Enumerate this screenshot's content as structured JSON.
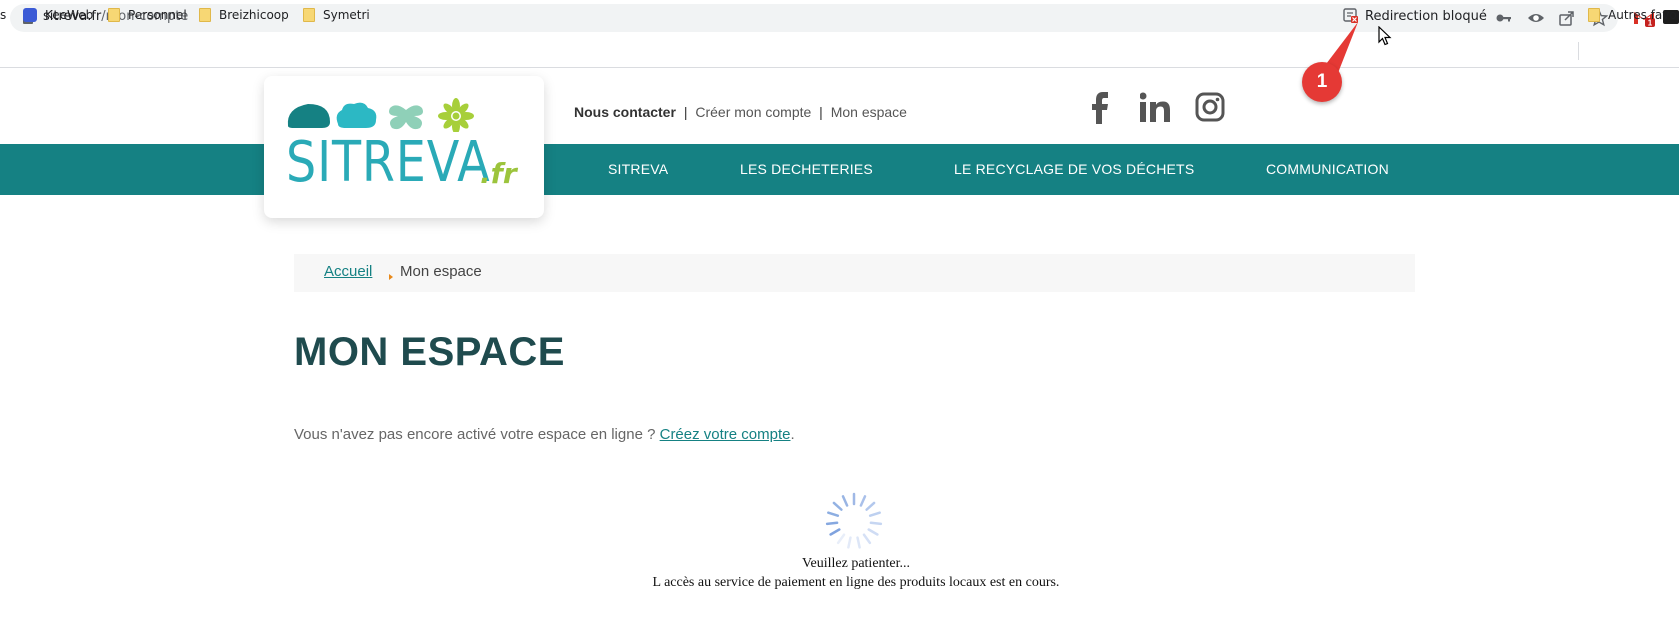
{
  "browser": {
    "url_host": "sitreva.fr",
    "url_path": "/mon-compte",
    "redirect_label": "Redirection bloqué",
    "gmail_badge": "1",
    "bookmarks": [
      {
        "label": "s"
      },
      {
        "label": "KeeWeb"
      },
      {
        "label": "Personnel"
      },
      {
        "label": "Breizhicoop"
      },
      {
        "label": "Symetri"
      },
      {
        "label": "Autres favoris"
      }
    ]
  },
  "annotation": {
    "number": "1",
    "color": "#e53935"
  },
  "site": {
    "logo_text": "SITREVA",
    "logo_suffix": ".fr",
    "top_links": {
      "contact": "Nous contacter",
      "create": "Créer mon compte",
      "space": "Mon espace",
      "separator": "|"
    },
    "nav": [
      "SITREVA",
      "LES DECHETERIES",
      "LE RECYCLAGE DE VOS DÉCHETS",
      "COMMUNICATION"
    ],
    "social": [
      "facebook-icon",
      "linkedin-icon",
      "instagram-icon"
    ],
    "nav_color": "#158183"
  },
  "content": {
    "breadcrumb_home": "Accueil",
    "breadcrumb_current": "Mon espace",
    "title": "MON ESPACE",
    "intro_text": "Vous n'avez pas encore activé votre espace en ligne ? ",
    "intro_link": "Créez votre compte",
    "intro_end": ".",
    "wait_line1": "Veuillez patienter...",
    "wait_line2": "L accès au service de paiement en ligne des produits locaux est en cours."
  }
}
